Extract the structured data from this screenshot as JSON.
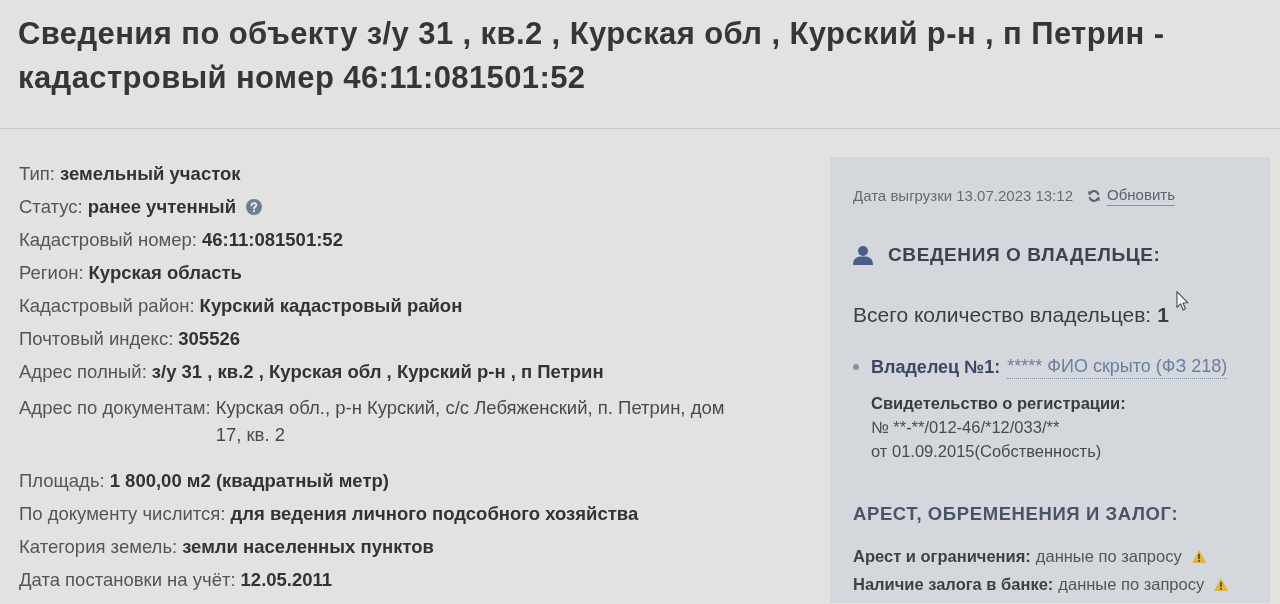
{
  "title": "Сведения по объекту з/у 31 , кв.2 , Курская обл , Курский р-н , п Петрин - кадастровый номер 46:11:081501:52",
  "sections": [
    {
      "fields": [
        {
          "kind": "plain",
          "label": "Тип:",
          "value": "земельный участок",
          "value_bold": true
        },
        {
          "kind": "help",
          "label": "Статус:",
          "value": "ранее учтенный",
          "value_bold": true
        },
        {
          "kind": "plain",
          "label": "Кадастровый номер:",
          "value": "46:11:081501:52",
          "value_bold": true
        },
        {
          "kind": "plain",
          "label": "Регион:",
          "value": "Курская область",
          "value_bold": true
        },
        {
          "kind": "plain",
          "label": "Кадастровый район:",
          "value": "Курский кадастровый район",
          "value_bold": true
        },
        {
          "kind": "plain",
          "label": "Почтовый индекс:",
          "value": "305526",
          "value_bold": true
        },
        {
          "kind": "plain",
          "label": "Адрес полный:",
          "value": "з/у 31 , кв.2 , Курская обл , Курский р-н , п Петрин",
          "value_bold": true
        },
        {
          "kind": "plain",
          "label": "Адрес по документам:",
          "value": "Курская обл., р-н Курский, с/с Лебяженский, п. Петрин, дом 17, кв. 2",
          "value_bold": false
        }
      ]
    },
    {
      "fields": [
        {
          "kind": "plain",
          "label": "Площадь:",
          "value": "1 800,00 м2 (квадратный метр)",
          "value_bold": true
        },
        {
          "kind": "plain",
          "label": "По документу числится:",
          "value": "для ведения личного подсобного хозяйства",
          "value_bold": true
        },
        {
          "kind": "plain",
          "label": "Категория земель:",
          "value": "земли населенных пунктов",
          "value_bold": true
        },
        {
          "kind": "plain",
          "label": "Дата постановки на учёт:",
          "value": "12.05.2011",
          "value_bold": true
        }
      ]
    }
  ],
  "panel": {
    "export_date": "Дата выгрузки 13.07.2023 13:12",
    "refresh_link": "Обновить",
    "owner_section": {
      "heading": "СВЕДЕНИЯ О ВЛАДЕЛЬЦЕ:",
      "total_label": "Всего количество владельцев:",
      "total_value": "1",
      "owners": [
        {
          "label": "Владелец №1:",
          "name": "***** ФИО скрыто (ФЗ 218)",
          "certificate": {
            "heading": "Свидетельство о регистрации:",
            "number": "№ **-**/012-46/*12/033/**",
            "date": "от 01.09.2015(Собственность)"
          }
        }
      ]
    },
    "encumbrance_section": {
      "heading": "АРЕСТ, ОБРЕМЕНЕНИЯ И ЗАЛОГ:",
      "items": [
        {
          "label": "Арест и ограничения:",
          "value": "данные по запросу",
          "warning": true
        },
        {
          "label": "Наличие залога в банке:",
          "value": "данные по запросу",
          "warning": true
        }
      ]
    }
  }
}
